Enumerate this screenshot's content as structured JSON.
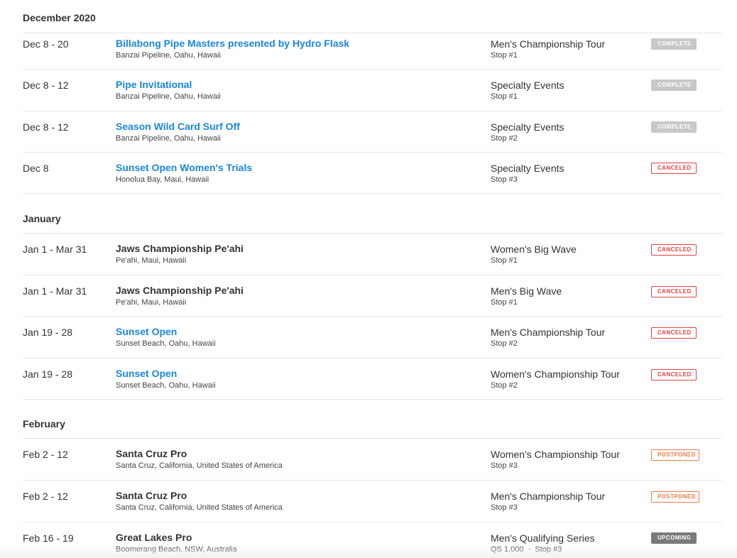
{
  "sections": [
    {
      "month": "December 2020",
      "events": [
        {
          "date": "Dec 8 - 20",
          "name": "Billabong Pipe Masters presented by Hydro Flask",
          "link": true,
          "location": "Banzai Pipeline, Oahu, Hawaii",
          "tour": "Men's Championship Tour",
          "stop": "Stop #1",
          "status": "COMPLETE",
          "status_type": "complete"
        },
        {
          "date": "Dec 8 - 12",
          "name": "Pipe Invitational",
          "link": true,
          "location": "Banzai Pipeline, Oahu, Hawaii",
          "tour": "Specialty Events",
          "stop": "Stop #1",
          "status": "COMPLETE",
          "status_type": "complete"
        },
        {
          "date": "Dec 8 - 12",
          "name": "Season Wild Card Surf Off",
          "link": true,
          "location": "Banzai Pipeline, Oahu, Hawaii",
          "tour": "Specialty Events",
          "stop": "Stop #2",
          "status": "COMPLETE",
          "status_type": "complete"
        },
        {
          "date": "Dec 8",
          "name": "Sunset Open Women's Trials",
          "link": true,
          "location": "Honolua Bay, Maui, Hawaii",
          "tour": "Specialty Events",
          "stop": "Stop #3",
          "status": "CANCELED",
          "status_type": "canceled"
        }
      ]
    },
    {
      "month": "January",
      "events": [
        {
          "date": "Jan 1 - Mar 31",
          "name": "Jaws Championship Pe'ahi",
          "link": false,
          "location": "Pe'ahi, Maui, Hawaii",
          "tour": "Women's Big Wave",
          "stop": "Stop #1",
          "status": "CANCELED",
          "status_type": "canceled"
        },
        {
          "date": "Jan 1 - Mar 31",
          "name": "Jaws Championship Pe'ahi",
          "link": false,
          "location": "Pe'ahi, Maui, Hawaii",
          "tour": "Men's Big Wave",
          "stop": "Stop #1",
          "status": "CANCELED",
          "status_type": "canceled"
        },
        {
          "date": "Jan 19 - 28",
          "name": "Sunset Open",
          "link": true,
          "location": "Sunset Beach, Oahu, Hawaii",
          "tour": "Men's Championship Tour",
          "stop": "Stop #2",
          "status": "CANCELED",
          "status_type": "canceled"
        },
        {
          "date": "Jan 19 - 28",
          "name": "Sunset Open",
          "link": true,
          "location": "Sunset Beach, Oahu, Hawaii",
          "tour": "Women's Championship Tour",
          "stop": "Stop #2",
          "status": "CANCELED",
          "status_type": "canceled"
        }
      ]
    },
    {
      "month": "February",
      "events": [
        {
          "date": "Feb 2 - 12",
          "name": "Santa Cruz Pro",
          "link": false,
          "location": "Santa Cruz, California, United States of America",
          "tour": "Women's Championship Tour",
          "stop": "Stop #3",
          "status": "POSTPONED",
          "status_type": "postponed"
        },
        {
          "date": "Feb 2 - 12",
          "name": "Santa Cruz Pro",
          "link": false,
          "location": "Santa Cruz, California, United States of America",
          "tour": "Men's Championship Tour",
          "stop": "Stop #3",
          "status": "POSTPONED",
          "status_type": "postponed"
        },
        {
          "date": "Feb 16 - 19",
          "name": "Great Lakes Pro",
          "link": false,
          "location": "Boomerang Beach, NSW, Australia",
          "tour": "Men's Qualifying Series",
          "stop": "QS 1,000  ·  Stop #3",
          "status": "UPCOMING",
          "status_type": "upcoming"
        }
      ]
    }
  ],
  "colors": {
    "link": "#1a86e0",
    "complete": "#c8c8c8",
    "canceled": "#e2433f",
    "postponed": "#f07b43",
    "upcoming": "#7a7a7a"
  }
}
